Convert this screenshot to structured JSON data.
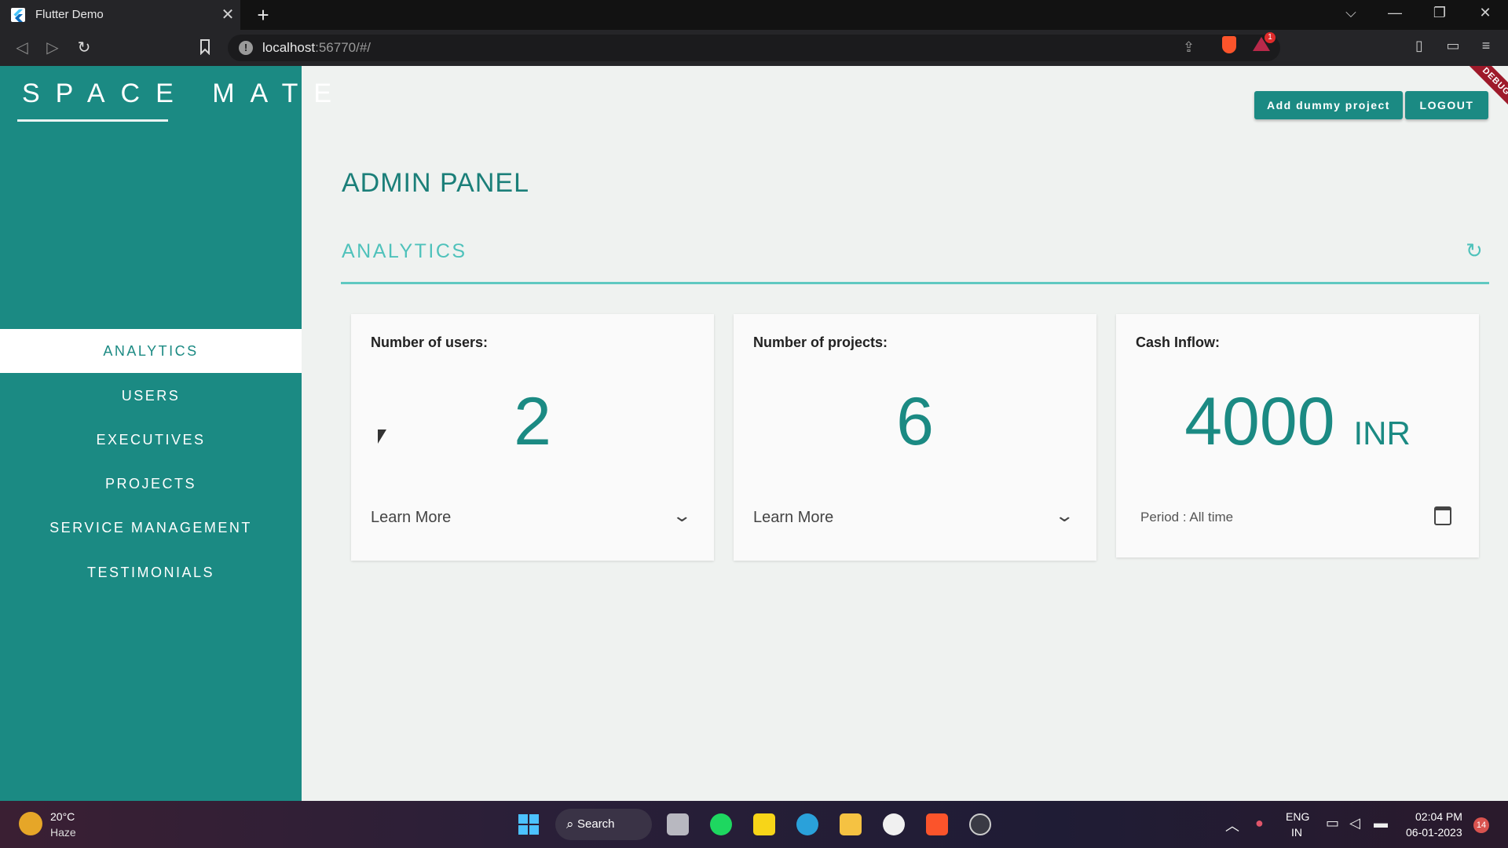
{
  "browser": {
    "tab_title": "Flutter Demo",
    "tab_close": "✕",
    "new_tab": "+",
    "url_host": "localhost",
    "url_rest": ":56770/#/",
    "rewards_badge": "1"
  },
  "window_controls": {
    "tab_list": "⌵",
    "minimize": "—",
    "restore": "❐",
    "close": "✕"
  },
  "app": {
    "logo": "SPACE MATE",
    "debug_banner": "DEBUG",
    "add_dummy_label": "Add dummy project",
    "logout_label": "LOGOUT",
    "page_title": "ADMIN PANEL",
    "section_title": "ANALYTICS",
    "nav_items": [
      {
        "label": "ANALYTICS",
        "active": true
      },
      {
        "label": "USERS",
        "active": false
      },
      {
        "label": "EXECUTIVES",
        "active": false
      },
      {
        "label": "PROJECTS",
        "active": false
      },
      {
        "label": "SERVICE MANAGEMENT",
        "active": false
      },
      {
        "label": "TESTIMONIALS",
        "active": false
      }
    ],
    "cards": {
      "users": {
        "label": "Number of users:",
        "value": "2",
        "footer": "Learn More"
      },
      "projects": {
        "label": "Number of projects:",
        "value": "6",
        "footer": "Learn More"
      },
      "cash": {
        "label": "Cash Inflow:",
        "value": "4000",
        "unit": "INR",
        "period": "Period : All time"
      }
    }
  },
  "taskbar": {
    "weather_temp": "20°C",
    "weather_desc": "Haze",
    "search_label": "Search",
    "lang_line1": "ENG",
    "lang_line2": "IN",
    "time": "02:04 PM",
    "date": "06-01-2023",
    "notification_count": "14"
  },
  "colors": {
    "brand_teal": "#1b8a83",
    "accent_teal": "#4fc2bb",
    "background": "#eff2f0"
  }
}
